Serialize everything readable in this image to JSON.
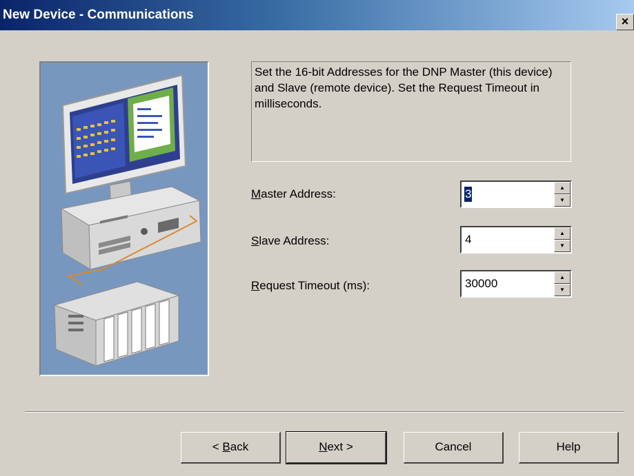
{
  "window": {
    "title": "New Device - Communications",
    "close_label": "×"
  },
  "description": "Set the 16-bit Addresses for the DNP Master (this device) and Slave (remote device).  Set the Request Timeout in milliseconds.",
  "fields": {
    "master": {
      "label_pre": "",
      "label_mnemonic": "M",
      "label_post": "aster Address:",
      "value": "3"
    },
    "slave": {
      "label_pre": "",
      "label_mnemonic": "S",
      "label_post": "lave Address:",
      "value": "4"
    },
    "timeout": {
      "label_pre": "",
      "label_mnemonic": "R",
      "label_post": "equest Timeout (ms):",
      "value": "30000"
    }
  },
  "spinner": {
    "up_glyph": "▲",
    "down_glyph": "▼"
  },
  "buttons": {
    "back": {
      "pre": "< ",
      "mnemonic": "B",
      "post": "ack"
    },
    "next": {
      "pre": "",
      "mnemonic": "N",
      "post": "ext >"
    },
    "cancel": "Cancel",
    "help": "Help"
  },
  "colors": {
    "title_start": "#0a246a",
    "title_end": "#a6caf0",
    "dialog_bg": "#d4d0c8",
    "illustration_bg": "#6f8fb8"
  },
  "icons": [
    "computer-illustration",
    "plc-device-illustration"
  ]
}
